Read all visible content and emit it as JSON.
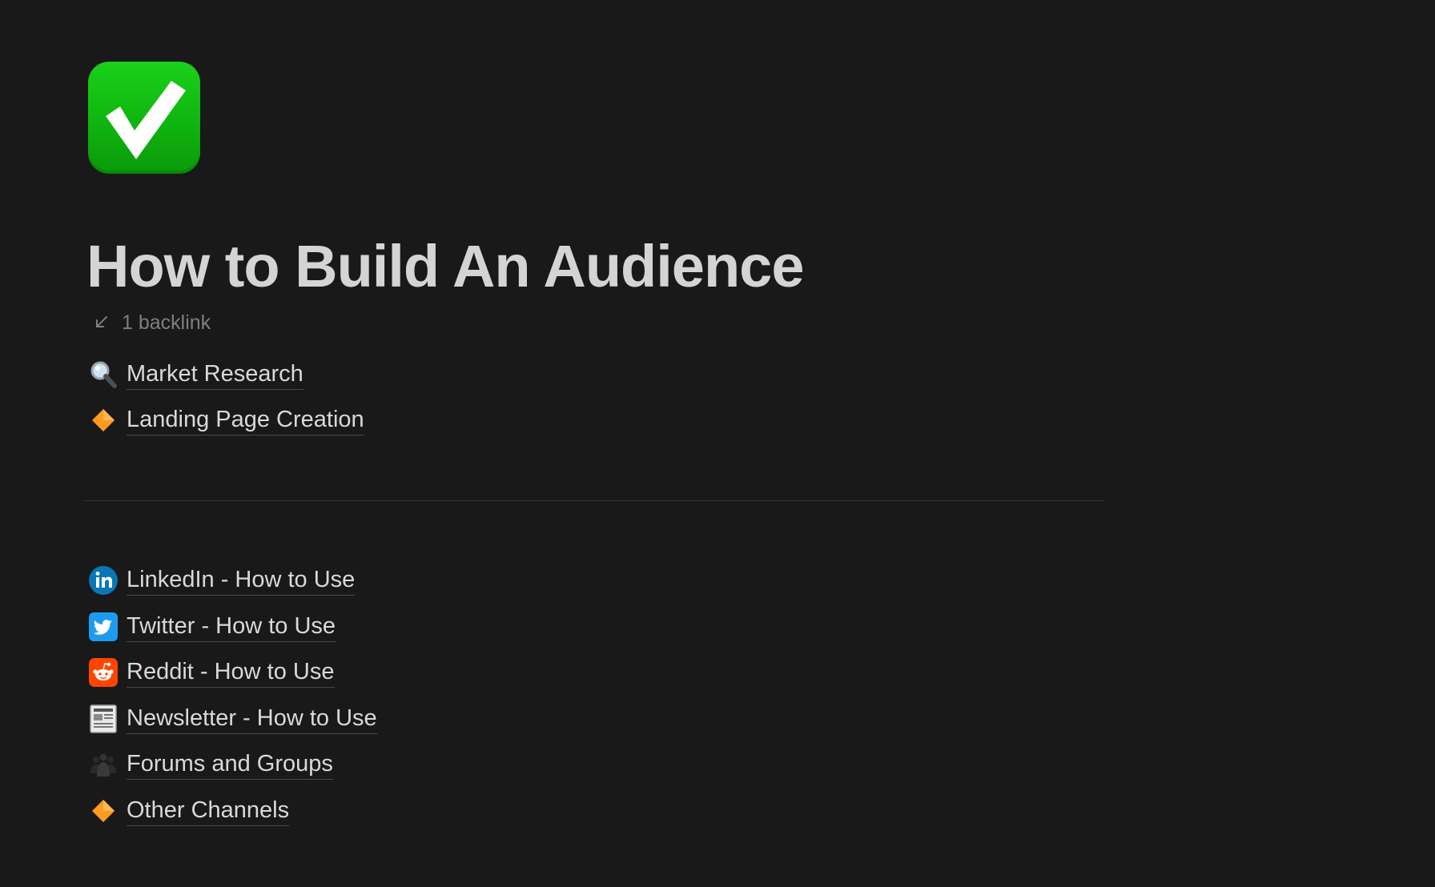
{
  "page": {
    "icon": "white-check-mark-icon",
    "title": "How to Build An Audience",
    "backlink_label": "1 backlink"
  },
  "links_top": [
    {
      "icon": "magnifying-glass-icon",
      "label": "Market Research"
    },
    {
      "icon": "orange-diamond-icon",
      "label": "Landing Page Creation"
    }
  ],
  "links_bottom": [
    {
      "icon": "linkedin-icon",
      "label": "LinkedIn - How to Use"
    },
    {
      "icon": "twitter-icon",
      "label": "Twitter - How to Use"
    },
    {
      "icon": "reddit-icon",
      "label": "Reddit - How to Use"
    },
    {
      "icon": "newspaper-icon",
      "label": "Newsletter - How to Use"
    },
    {
      "icon": "people-group-icon",
      "label": "Forums and Groups"
    },
    {
      "icon": "orange-diamond-icon",
      "label": "Other Channels"
    }
  ],
  "colors": {
    "background": "#191919",
    "text": "#d4d4d4",
    "muted": "#7f7f7f",
    "check_green": "#11c111"
  }
}
